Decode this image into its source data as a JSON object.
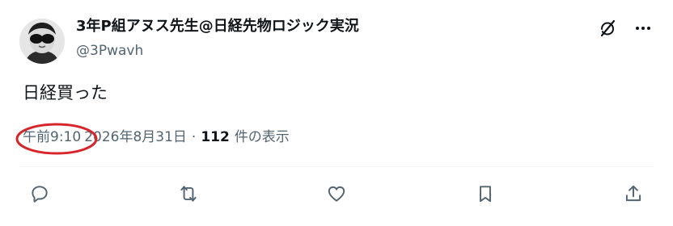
{
  "author": {
    "display_name": "3年P組アヌス先生@日経先物ロジック実況",
    "handle": "@3Pwavh"
  },
  "post": {
    "text": "日経買った",
    "time": "午前9:10",
    "date": "2026年8月31日",
    "separator": "·",
    "view_count": "112",
    "view_label": "件の表示"
  },
  "icons": {
    "grok": "grok-icon",
    "more": "more-icon",
    "reply": "reply-icon",
    "repost": "repost-icon",
    "like": "like-icon",
    "bookmark": "bookmark-icon",
    "share": "share-icon"
  },
  "colors": {
    "text": "#0f1419",
    "muted": "#536471",
    "annotation": "#d7262b",
    "divider": "#eff3f4"
  }
}
